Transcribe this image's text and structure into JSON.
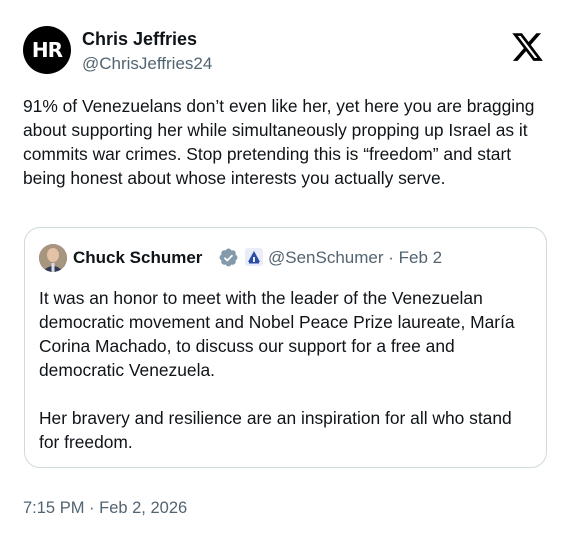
{
  "author": {
    "name": "Chris Jeffries",
    "handle": "@ChrisJeffries24",
    "avatar_text": "HR"
  },
  "tweet": {
    "text": "91% of Venezuelans don’t even like her, yet here you are bragging about supporting her while simultaneously propping up Israel as it commits war crimes. Stop pretending this is “freedom” and start being honest about whose interests you actually serve.",
    "timestamp": "7:15 PM · Feb 2, 2026"
  },
  "quoted_tweet": {
    "name": "Chuck Schumer",
    "handle_date": "@SenSchumer · Feb 2",
    "paragraphs": [
      "It was an honor to meet with the leader of the Venezuelan democratic movement and Nobel Peace Prize laureate, María Corina Machado, to discuss our support for a free and democratic Venezuela.",
      "Her bravery and resilience are an inspiration for all who stand for freedom."
    ],
    "verified_color": "#829aab",
    "affiliation_icon": "government-building-icon"
  },
  "icons": {
    "platform_logo": "x-logo-icon",
    "verified": "verified-badge-icon"
  },
  "colors": {
    "text": "#0f1419",
    "secondary_text": "#536471",
    "border": "#cfd9de"
  }
}
